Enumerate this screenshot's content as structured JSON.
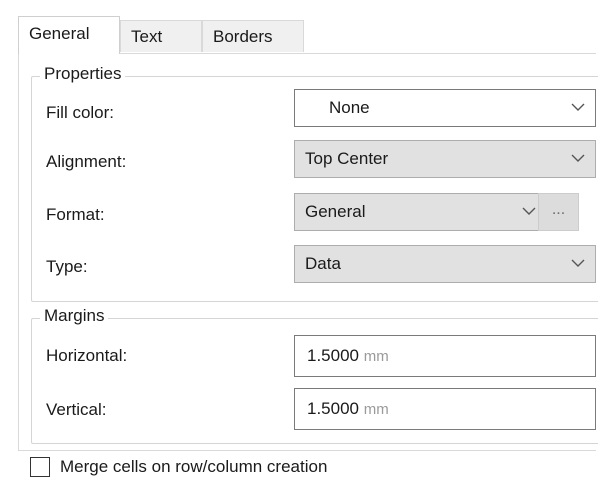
{
  "tabs": [
    {
      "label": "General",
      "active": true
    },
    {
      "label": "Text",
      "active": false
    },
    {
      "label": "Borders",
      "active": false
    }
  ],
  "properties": {
    "legend": "Properties",
    "fill_color": {
      "label": "Fill color:",
      "value": "None"
    },
    "alignment": {
      "label": "Alignment:",
      "value": "Top Center"
    },
    "format": {
      "label": "Format:",
      "value": "General",
      "ellipsis": "..."
    },
    "type": {
      "label": "Type:",
      "value": "Data"
    }
  },
  "margins": {
    "legend": "Margins",
    "horizontal": {
      "label": "Horizontal:",
      "value": "1.5000",
      "unit": "mm"
    },
    "vertical": {
      "label": "Vertical:",
      "value": "1.5000",
      "unit": "mm"
    }
  },
  "merge_cells": {
    "label": "Merge cells on row/column creation",
    "checked": false
  },
  "colors": {
    "chevron": "#555555",
    "combo_bg": "#e1e1e1",
    "border": "#7a7a7a"
  },
  "icons": {
    "chevron": "chevron-down-icon"
  }
}
